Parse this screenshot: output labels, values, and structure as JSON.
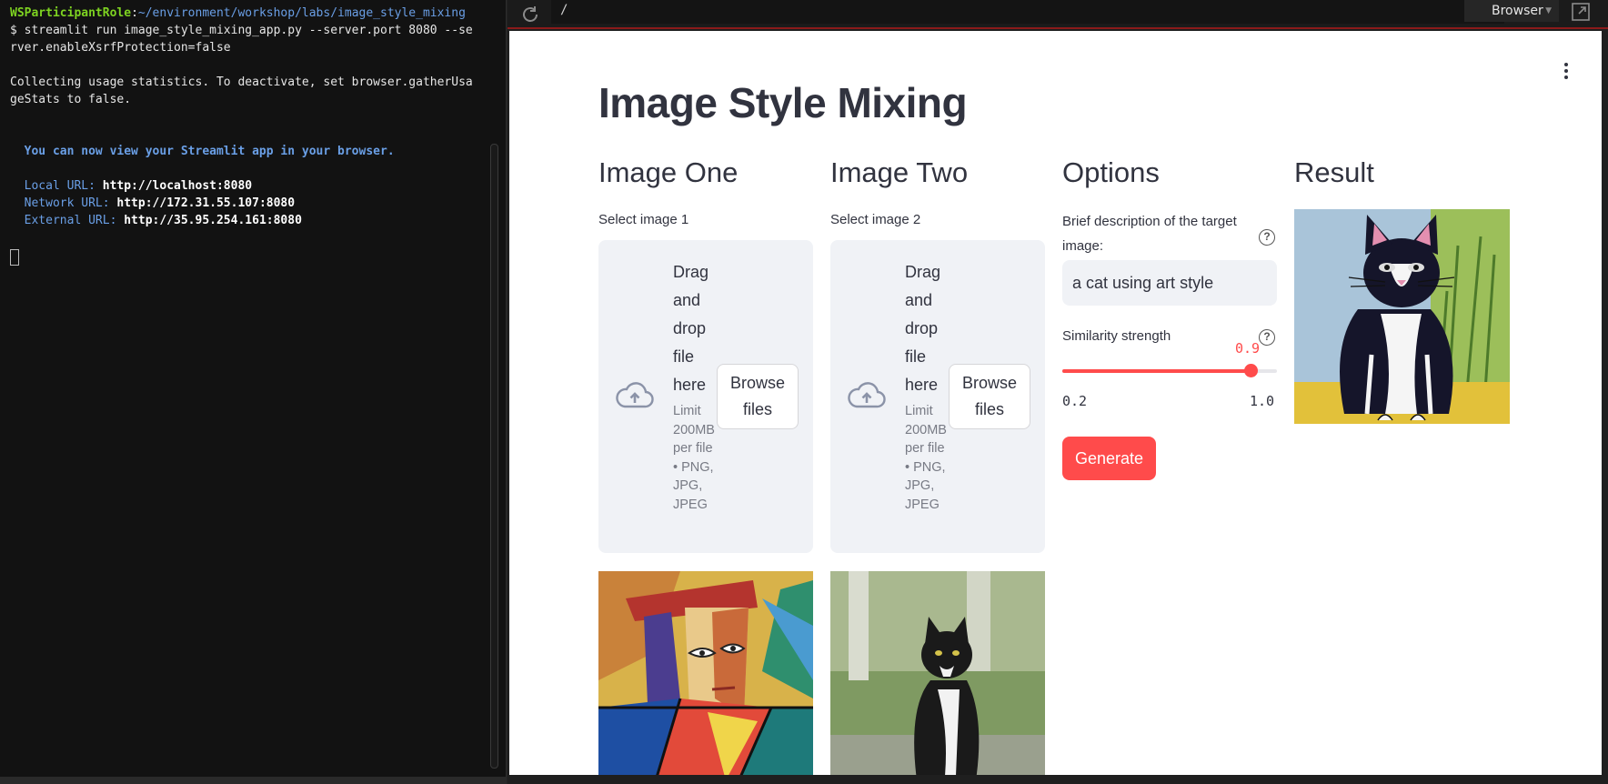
{
  "terminal": {
    "prompt_user": "WSParticipantRole",
    "prompt_path": "~/environment/workshop/labs/image_style_mixing",
    "command_line_1": "$ streamlit run image_style_mixing_app.py --server.port 8080 --se",
    "command_line_2": "rver.enableXsrfProtection=false",
    "stats_line_1": "Collecting usage statistics. To deactivate, set browser.gatherUsa",
    "stats_line_2": "geStats to false.",
    "ready_message": "  You can now view your Streamlit app in your browser.",
    "local_label": "  Local URL:",
    "local_url": "http://localhost:8080",
    "network_label": "  Network URL:",
    "network_url": "http://172.31.55.107:8080",
    "external_label": "  External URL:",
    "external_url": "http://35.95.254.161:8080"
  },
  "browser": {
    "url": "/",
    "menu_label": "Browser",
    "reload_icon": "reload-icon",
    "popout_icon": "popout-icon"
  },
  "app": {
    "title": "Image Style Mixing",
    "columns": {
      "image_one": {
        "header": "Image One",
        "select_label": "Select image 1",
        "dropzone": {
          "drag_text": "Drag and drop file here",
          "limit_text": "Limit 200MB per file • PNG, JPG, JPEG",
          "browse_label": "Browse files",
          "icon": "cloud-upload-icon"
        }
      },
      "image_two": {
        "header": "Image Two",
        "select_label": "Select image 2",
        "dropzone": {
          "drag_text": "Drag and drop file here",
          "limit_text": "Limit 200MB per file • PNG, JPG, JPEG",
          "browse_label": "Browse files",
          "icon": "cloud-upload-icon"
        }
      },
      "options": {
        "header": "Options",
        "description_label": "Brief description of the target image:",
        "description_value": "a cat using art style",
        "similarity_label": "Similarity strength",
        "similarity_value": "0.9",
        "similarity_fraction": 0.875,
        "slider_min": "0.2",
        "slider_max": "1.0",
        "generate_label": "Generate"
      },
      "result": {
        "header": "Result"
      }
    }
  },
  "colors": {
    "accent": "#ff4b4b",
    "text": "#31333f",
    "widget_bg": "#f0f2f6",
    "terminal_bg": "#121212"
  }
}
